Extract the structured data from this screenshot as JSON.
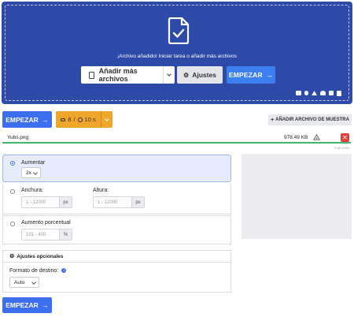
{
  "upload": {
    "status_text": "¡Archivo añadido! Iniciar tarea o añadir más archivos",
    "add_files_label": "Añadir más archivos",
    "settings_label": "Ajustes",
    "start_label": "EMPEZAR",
    "cloud_icons": [
      "folder-icon",
      "link-icon",
      "google-drive-icon",
      "dropbox-icon",
      "onedrive-icon",
      "paste-icon"
    ]
  },
  "toolbar": {
    "start_label": "EMPEZAR",
    "credits": "8",
    "time": "10 s",
    "add_sample_label": "AÑADIR ARCHIVO DE MUESTRA"
  },
  "file": {
    "name": "Yubs.png",
    "size": "978.49 KB",
    "delete_label": "✕",
    "corner_label": "PUBLISHER"
  },
  "options": {
    "upscale": {
      "label": "Aumentar",
      "selected": "2x",
      "selected_state": true
    },
    "dimensions": {
      "width_label": "Anchura:",
      "width_placeholder": "1 - 12000",
      "width_unit": "px",
      "height_label": "Altura:",
      "height_placeholder": "1 - 12000",
      "height_unit": "px"
    },
    "percent": {
      "label": "Aumento porcentual",
      "placeholder": "101 - 400",
      "unit": "%"
    }
  },
  "optional": {
    "title": "Ajustes opcionales",
    "format_label": "Formato de destino:",
    "format_value": "Auto"
  },
  "bottom": {
    "start_label": "EMPEZAR"
  },
  "colors": {
    "dropzone": "#2d4aa8",
    "primary": "#3b6ff0",
    "credits": "#f0a52b",
    "success": "#42b56b",
    "danger": "#e04040"
  }
}
